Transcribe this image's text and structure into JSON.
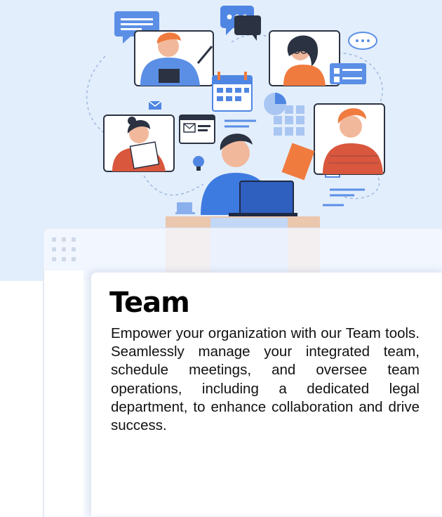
{
  "feature": {
    "title": "Team",
    "description": "Empower your organization with our Team tools. Seamlessly manage your integrated team, schedule meetings, and oversee team operations, including a dedicated legal department, to enhance collaboration and drive success."
  },
  "illustration": {
    "subject": "remote team video conference",
    "colors": {
      "background": "#e3eefc",
      "accent_blue": "#3e7be0",
      "accent_orange": "#f07b3f"
    }
  }
}
